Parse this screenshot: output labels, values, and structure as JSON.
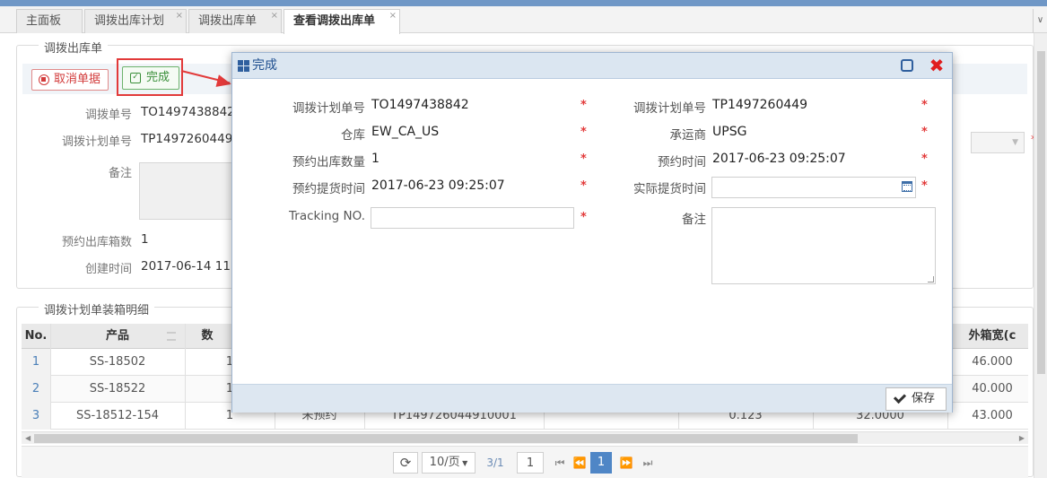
{
  "tabs": [
    {
      "label": "主面板"
    },
    {
      "label": "调拨出库计划"
    },
    {
      "label": "调拨出库单"
    },
    {
      "label": "查看调拨出库单"
    }
  ],
  "tab_close": "×",
  "tab_scroll": "∨",
  "form_section": {
    "legend": "调拨出库单",
    "cancel_label": "取消单据",
    "done_label": "完成",
    "fields": [
      {
        "label": "调拨单号",
        "value": "TO1497438842"
      },
      {
        "label": "调拨计划单号",
        "value": "TP1497260449"
      },
      {
        "label": "备注",
        "value": ""
      },
      {
        "label": "预约出库箱数",
        "value": "1"
      },
      {
        "label": "创建时间",
        "value": "2017-06-14 11"
      }
    ]
  },
  "table_section": {
    "legend": "调拨计划单装箱明细",
    "columns": [
      "No.",
      "产品",
      "数",
      "外箱宽(c"
    ],
    "rows": [
      {
        "no": "1",
        "product": "SS-18502",
        "qty": "1",
        "status": "",
        "plan": "",
        "extra1": "",
        "extra2": "",
        "extra3": "",
        "width": "46.000"
      },
      {
        "no": "2",
        "product": "SS-18522",
        "qty": "1",
        "status": "",
        "plan": "",
        "extra1": "",
        "extra2": "",
        "extra3": "",
        "width": "40.000"
      },
      {
        "no": "3",
        "product": "SS-18512-154",
        "qty": "1",
        "status": "未预约",
        "plan": "TP149726044910001",
        "extra1": "",
        "extra2": "0.123",
        "extra3": "32.0000",
        "width": "43.000"
      }
    ]
  },
  "pager": {
    "page_size": "10/页",
    "page_info": "3/1",
    "page_input": "1",
    "current_page": "1"
  },
  "dialog": {
    "title": "完成",
    "close_glyph": "✖",
    "left_fields": [
      {
        "label": "调拨计划单号",
        "value": "TO1497438842"
      },
      {
        "label": "仓库",
        "value": "EW_CA_US"
      },
      {
        "label": "预约出库数量",
        "value": "1"
      },
      {
        "label": "预约提货时间",
        "value": "2017-06-23 09:25:07"
      },
      {
        "label": "Tracking NO.",
        "value": ""
      }
    ],
    "right_fields": [
      {
        "label": "调拨计划单号",
        "value": "TP1497260449"
      },
      {
        "label": "承运商",
        "value": "UPSG"
      },
      {
        "label": "预约时间",
        "value": "2017-06-23 09:25:07"
      },
      {
        "label": "实际提货时间",
        "value": ""
      },
      {
        "label": "备注",
        "value": ""
      }
    ],
    "required_mark": "*",
    "save_label": "保存"
  },
  "colors": {
    "accent": "#4f86c6",
    "danger": "#e23a3a",
    "success": "#3a8f3a",
    "dialog_title_bg": "#dbe6f1"
  }
}
